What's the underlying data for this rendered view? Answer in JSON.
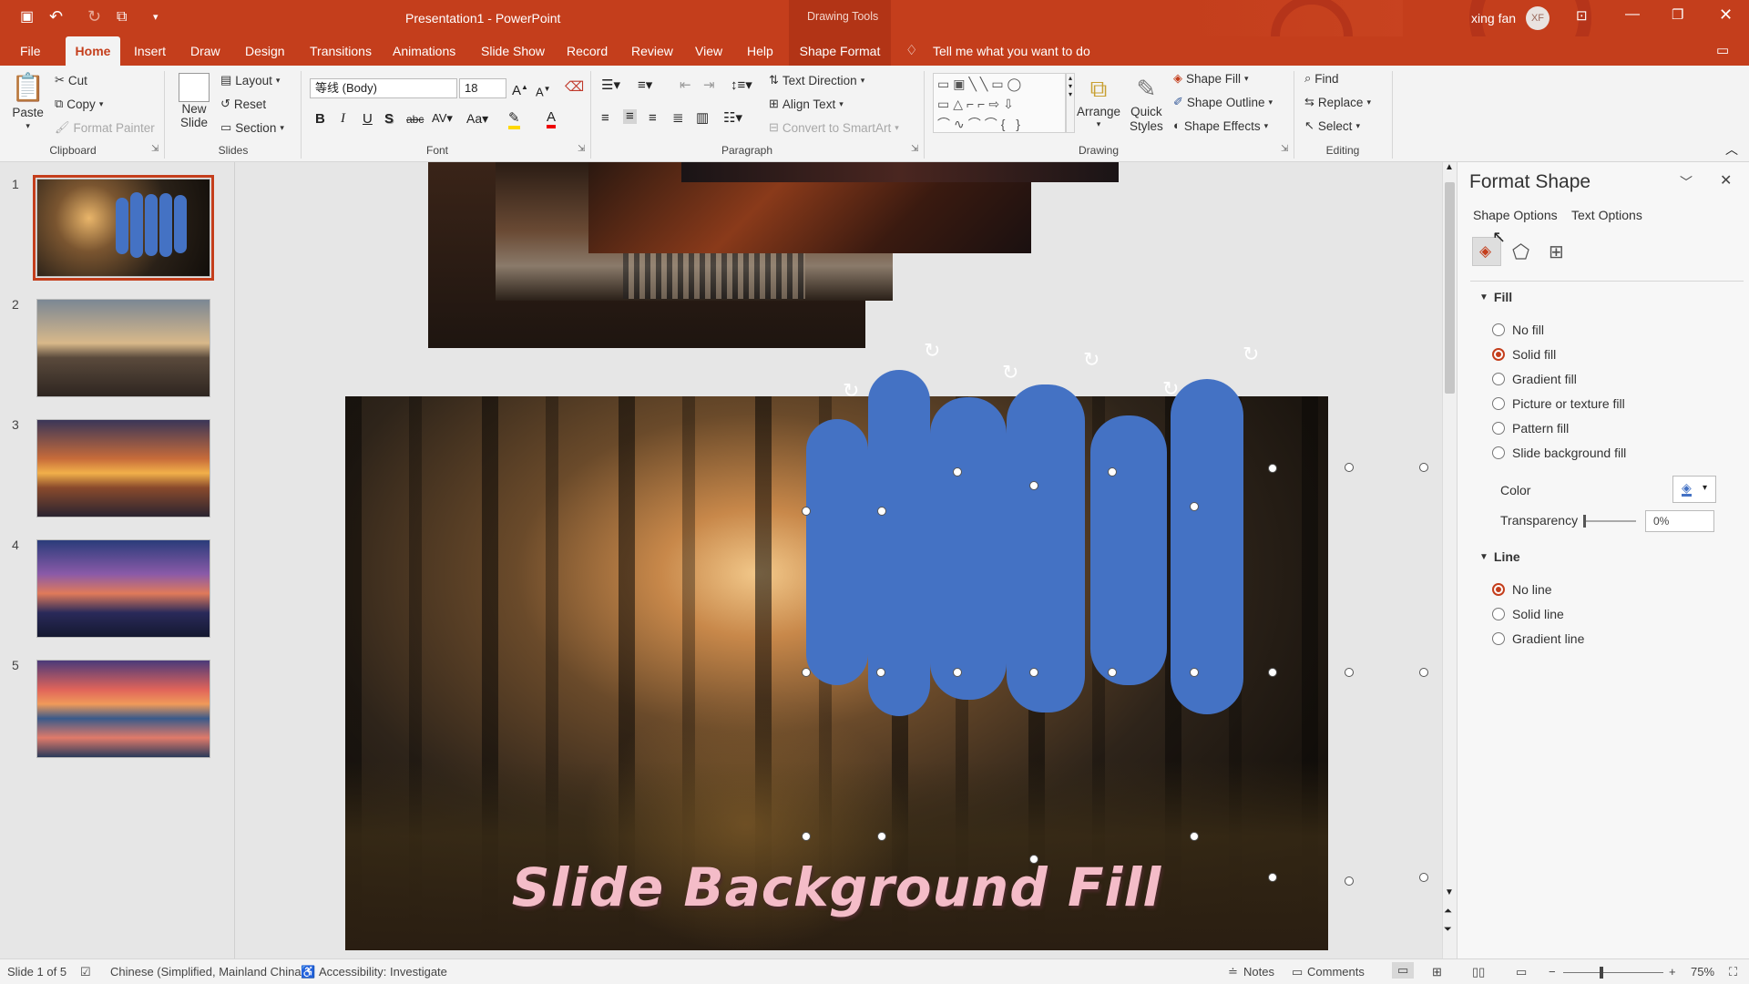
{
  "titlebar": {
    "title": "Presentation1  -  PowerPoint",
    "contextual": "Drawing Tools",
    "user_name": "xing fan",
    "user_initials": "XF"
  },
  "tabs": [
    "File",
    "Home",
    "Insert",
    "Draw",
    "Design",
    "Transitions",
    "Animations",
    "Slide Show",
    "Record",
    "Review",
    "View",
    "Help",
    "Shape Format"
  ],
  "tell_me": "Tell me what you want to do",
  "ribbon": {
    "clipboard": {
      "paste": "Paste",
      "cut": "Cut",
      "copy": "Copy",
      "format_painter": "Format Painter",
      "label": "Clipboard"
    },
    "slides": {
      "new_slide": "New",
      "new_slide2": "Slide",
      "layout": "Layout",
      "reset": "Reset",
      "section": "Section",
      "label": "Slides"
    },
    "font": {
      "name": "等线 (Body)",
      "size": "18",
      "label": "Font"
    },
    "paragraph": {
      "text_direction": "Text Direction",
      "align_text": "Align Text",
      "smartart": "Convert to SmartArt",
      "label": "Paragraph"
    },
    "drawing": {
      "arrange": "Arrange",
      "quick_styles": "Quick",
      "quick_styles2": "Styles",
      "shape_fill": "Shape Fill",
      "shape_outline": "Shape Outline",
      "shape_effects": "Shape Effects",
      "label": "Drawing"
    },
    "editing": {
      "find": "Find",
      "replace": "Replace",
      "select": "Select",
      "label": "Editing"
    }
  },
  "slides": [
    {
      "num": "1"
    },
    {
      "num": "2"
    },
    {
      "num": "3"
    },
    {
      "num": "4"
    },
    {
      "num": "5"
    }
  ],
  "slide": {
    "title_text": "Slide Background Fill"
  },
  "pane": {
    "title": "Format Shape",
    "tab_shape": "Shape Options",
    "tab_text": "Text Options",
    "fill_section": "Fill",
    "fill_options": [
      "No fill",
      "Solid fill",
      "Gradient fill",
      "Picture or texture fill",
      "Pattern fill",
      "Slide background fill"
    ],
    "fill_selected": "Solid fill",
    "color_label": "Color",
    "transparency_label": "Transparency",
    "transparency_value": "0%",
    "line_section": "Line",
    "line_options": [
      "No line",
      "Solid line",
      "Gradient line"
    ],
    "line_selected": "No line"
  },
  "status": {
    "slide_count": "Slide 1 of 5",
    "language": "Chinese (Simplified, Mainland China)",
    "accessibility": "Accessibility: Investigate",
    "notes": "Notes",
    "comments": "Comments",
    "zoom": "75%"
  },
  "colors": {
    "accent": "#c43e1c",
    "shape_fill": "#4472c4",
    "slide_text": "#f4bcc8"
  }
}
